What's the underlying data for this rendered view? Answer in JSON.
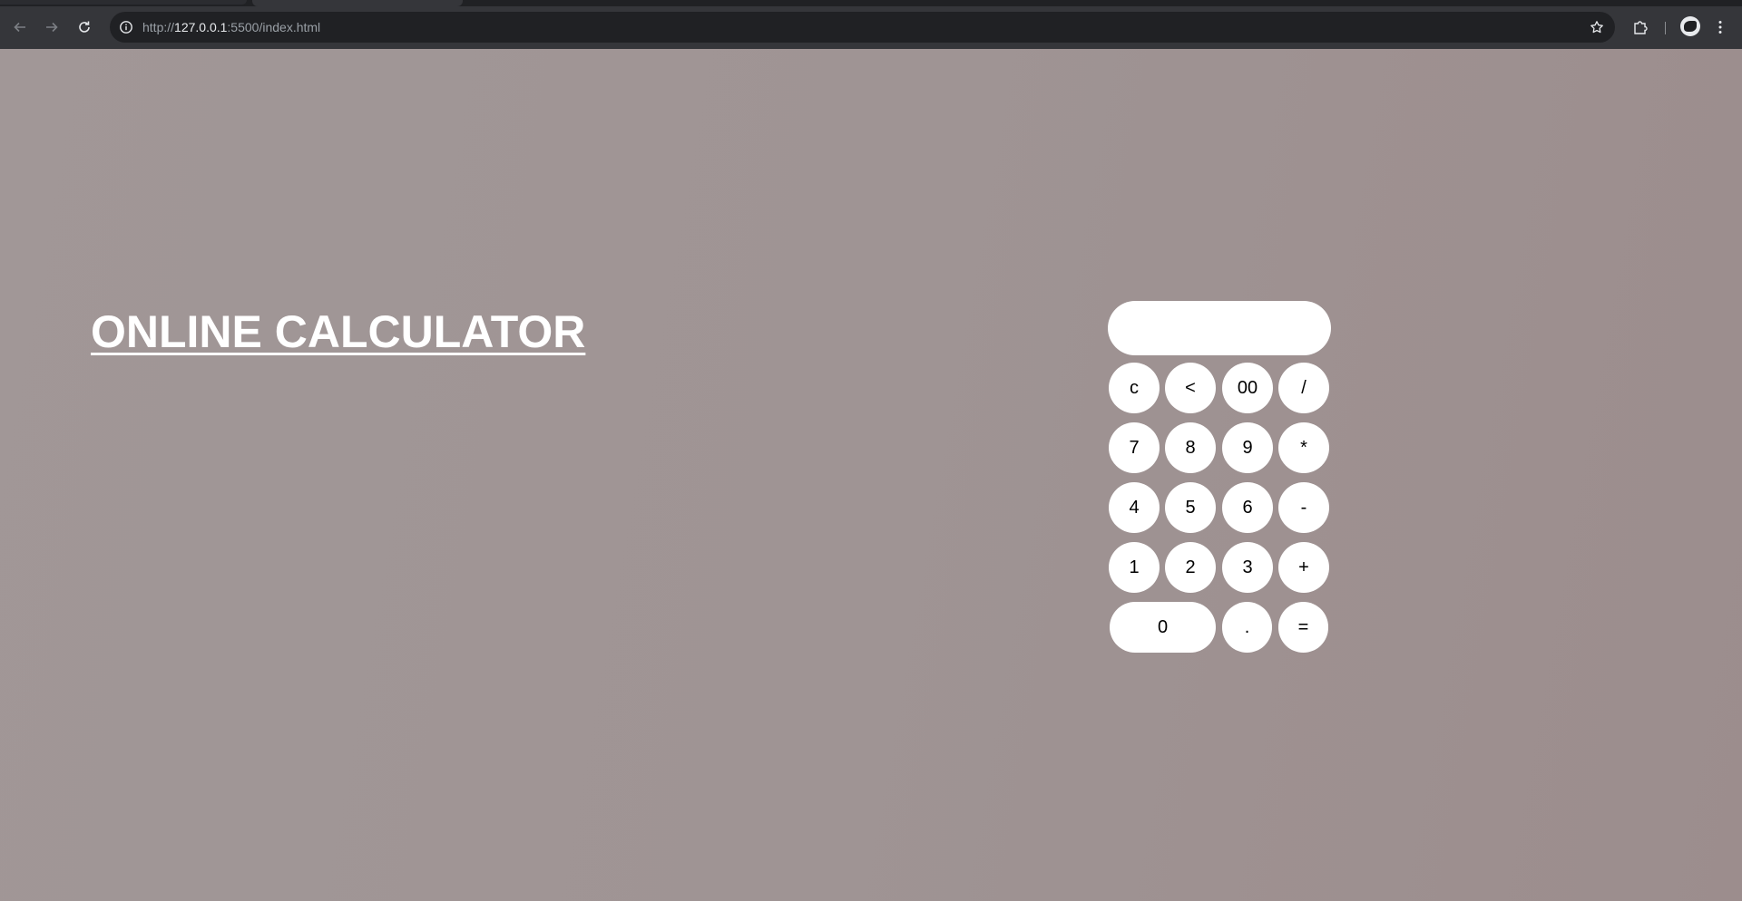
{
  "browser": {
    "url_scheme": "http://",
    "url_host": "127.0.0.1",
    "url_rest": ":5500/index.html"
  },
  "page": {
    "title": "ONLINE CALCULATOR"
  },
  "calculator": {
    "display_value": "",
    "keys": {
      "clear": "c",
      "backspace": "<",
      "double_zero": "00",
      "divide": "/",
      "seven": "7",
      "eight": "8",
      "nine": "9",
      "multiply": "*",
      "four": "4",
      "five": "5",
      "six": "6",
      "minus": "-",
      "one": "1",
      "two": "2",
      "three": "3",
      "plus": "+",
      "zero": "0",
      "decimal": ".",
      "equals": "="
    }
  }
}
